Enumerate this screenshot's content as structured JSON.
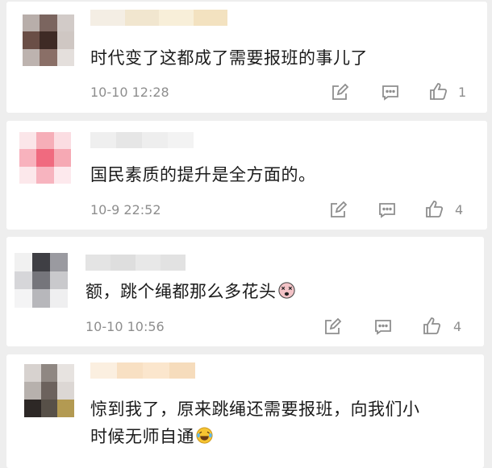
{
  "comments": [
    {
      "text": "时代变了这都成了需要报班的事儿了",
      "time": "10-10 12:28",
      "likes": "1",
      "avatar_colors": [
        "#b8aeaa",
        "#7b655f",
        "#d2cbc8",
        "#6a4e46",
        "#3e2a25",
        "#cfc7c3",
        "#bdb3af",
        "#8a6f67",
        "#e4dfdc"
      ],
      "name_colors": [
        "#f4eee4",
        "#f1e6cf",
        "#f8efd9",
        "#f3e2c0"
      ]
    },
    {
      "text": "国民素质的提升是全方面的。",
      "time": "10-9 22:52",
      "likes": "4",
      "avatar_colors": [
        "#fbe6e9",
        "#f6aeb8",
        "#fbdde2",
        "#f8b2bd",
        "#f06a7f",
        "#f6a9b4",
        "#fce8eb",
        "#f7b4bf",
        "#fde9ed"
      ],
      "name_colors": [
        "#efefef",
        "#e6e6e6",
        "#eeeeee",
        "#f3f3f3"
      ]
    },
    {
      "text": "额，跳个绳都那么多花头",
      "time": "10-10 10:56",
      "likes": "4",
      "avatar_colors": [
        "#f1f1f1",
        "#3f3f44",
        "#9a9aa0",
        "#d6d6d9",
        "#75757b",
        "#c9c9cc",
        "#f4f4f5",
        "#b7b7bb",
        "#efeff0"
      ],
      "name_colors": [
        "#e4e4e4",
        "#dedede",
        "#e8e8e8",
        "#e2e2e2"
      ]
    },
    {
      "text_line1": "惊到我了，原来跳绳还需要报班，向我们小",
      "text_line2": "时候无师自通",
      "avatar_colors": [
        "#d7d2cf",
        "#8f8782",
        "#e7e3e0",
        "#b7b1ad",
        "#6c625d",
        "#dcd7d4",
        "#2d2826",
        "#575048",
        "#b39a52"
      ],
      "name_colors": [
        "#fbefe0",
        "#f8e0c3",
        "#fbe6cd",
        "#f6dcbc"
      ]
    }
  ],
  "icons": {
    "edit": "edit-icon",
    "comment": "comment-icon",
    "like": "thumbs-up-icon",
    "emoji_dizzy": "dizzy-face-emoji",
    "emoji_laugh": "laughing-tears-emoji"
  }
}
